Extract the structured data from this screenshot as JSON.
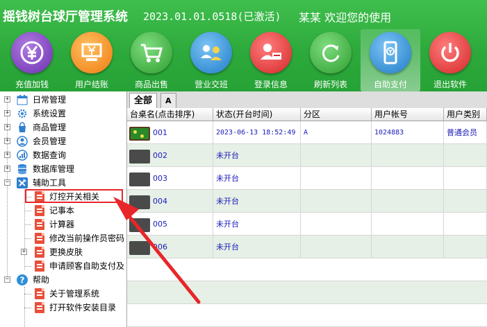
{
  "app": {
    "title": "摇钱树台球厅管理系统",
    "version": "2023.01.01.0518(已激活)",
    "welcome": "某某 欢迎您的使用"
  },
  "toolbar": [
    {
      "label": "充值加钱",
      "icon": "money-icon",
      "color": "#7a3fb8"
    },
    {
      "label": "用户结账",
      "icon": "cashier-icon",
      "color": "#f08a1c"
    },
    {
      "label": "商品出售",
      "icon": "cart-icon",
      "color": "#3aab3a"
    },
    {
      "label": "营业交班",
      "icon": "users-swap-icon",
      "color": "#2f8fd8"
    },
    {
      "label": "登录信息",
      "icon": "login-info-icon",
      "color": "#e33d3d"
    },
    {
      "label": "刷新列表",
      "icon": "refresh-icon",
      "color": "#3aab3a"
    },
    {
      "label": "自助支付",
      "icon": "phone-pay-icon",
      "color": "#2f8fd8"
    },
    {
      "label": "退出软件",
      "icon": "power-icon",
      "color": "#e33d3d"
    }
  ],
  "sidebar": {
    "items": [
      {
        "label": "日常管理"
      },
      {
        "label": "系统设置"
      },
      {
        "label": "商品管理"
      },
      {
        "label": "会员管理"
      },
      {
        "label": "数据查询"
      },
      {
        "label": "数据库管理"
      },
      {
        "label": "辅助工具"
      },
      {
        "label": "灯控开关相关"
      },
      {
        "label": "记事本"
      },
      {
        "label": "计算器"
      },
      {
        "label": "修改当前操作员密码"
      },
      {
        "label": "更换皮肤"
      },
      {
        "label": "申请顾客自助支付及"
      },
      {
        "label": "帮助"
      },
      {
        "label": "关于管理系统"
      },
      {
        "label": "打开软件安装目录"
      }
    ]
  },
  "tabs": [
    {
      "label": "全部"
    },
    {
      "label": "A"
    }
  ],
  "table": {
    "columns": [
      "台桌名(点击排序)",
      "状态(开台时间)",
      "分区",
      "用户帐号",
      "用户类别"
    ],
    "rows": [
      {
        "name": "001",
        "status": "2023-06-13 18:52:49",
        "zone": "A",
        "account": "1024883",
        "type": "普通会员"
      },
      {
        "name": "002",
        "status": "未开台",
        "zone": "",
        "account": "",
        "type": ""
      },
      {
        "name": "003",
        "status": "未开台",
        "zone": "",
        "account": "",
        "type": ""
      },
      {
        "name": "004",
        "status": "未开台",
        "zone": "",
        "account": "",
        "type": ""
      },
      {
        "name": "005",
        "status": "未开台",
        "zone": "",
        "account": "",
        "type": ""
      },
      {
        "name": "006",
        "status": "未开台",
        "zone": "",
        "account": "",
        "type": ""
      }
    ]
  },
  "colors": {
    "header_green": "#2eaa3c",
    "row_alt": "#e6f0e6",
    "link_blue": "#1a1ab8",
    "annotation_red": "#e8262a"
  }
}
